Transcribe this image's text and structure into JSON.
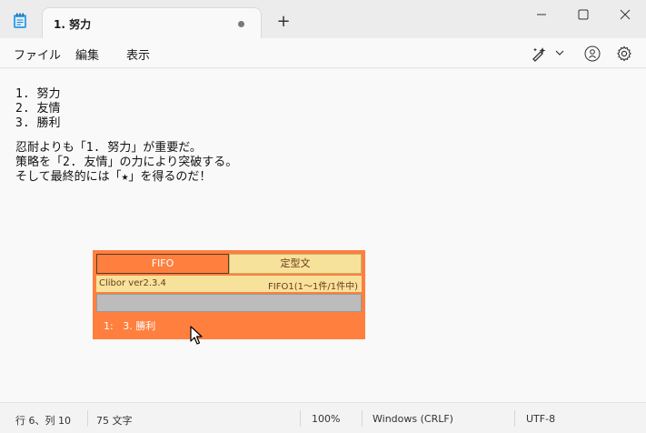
{
  "tab": {
    "title": "1. 努力"
  },
  "menu": {
    "file": "ファイル",
    "edit": "編集",
    "view": "表示"
  },
  "editor": {
    "lines": [
      "1. 努力",
      "2. 友情",
      "3. 勝利",
      "",
      "忍耐よりも「1. 努力」が重要だ。",
      "策略を「2. 友情」の力により突破する。",
      "そして最終的には「★」を得るのだ！"
    ]
  },
  "clibor": {
    "tab_fifo": "FIFO",
    "tab_teikei": "定型文",
    "version": "Clibor ver2.3.4",
    "count": "FIFO1(1〜1件/1件中)",
    "item_index": "1:",
    "item_text": "3. 勝利",
    "colors": {
      "accent": "#ff7f3f",
      "panel": "#f7e29b",
      "search": "#bcbcbc"
    }
  },
  "status": {
    "position": "行 6、列 10",
    "chars": "75 文字",
    "zoom": "100%",
    "line_ending": "Windows (CRLF)",
    "encoding": "UTF-8"
  },
  "icons": [
    "notepad-icon",
    "add-tab-icon",
    "minimize-icon",
    "maximize-icon",
    "close-icon",
    "copilot-icon",
    "chevron-down-icon",
    "account-icon",
    "gear-icon",
    "mouse-cursor-icon"
  ]
}
